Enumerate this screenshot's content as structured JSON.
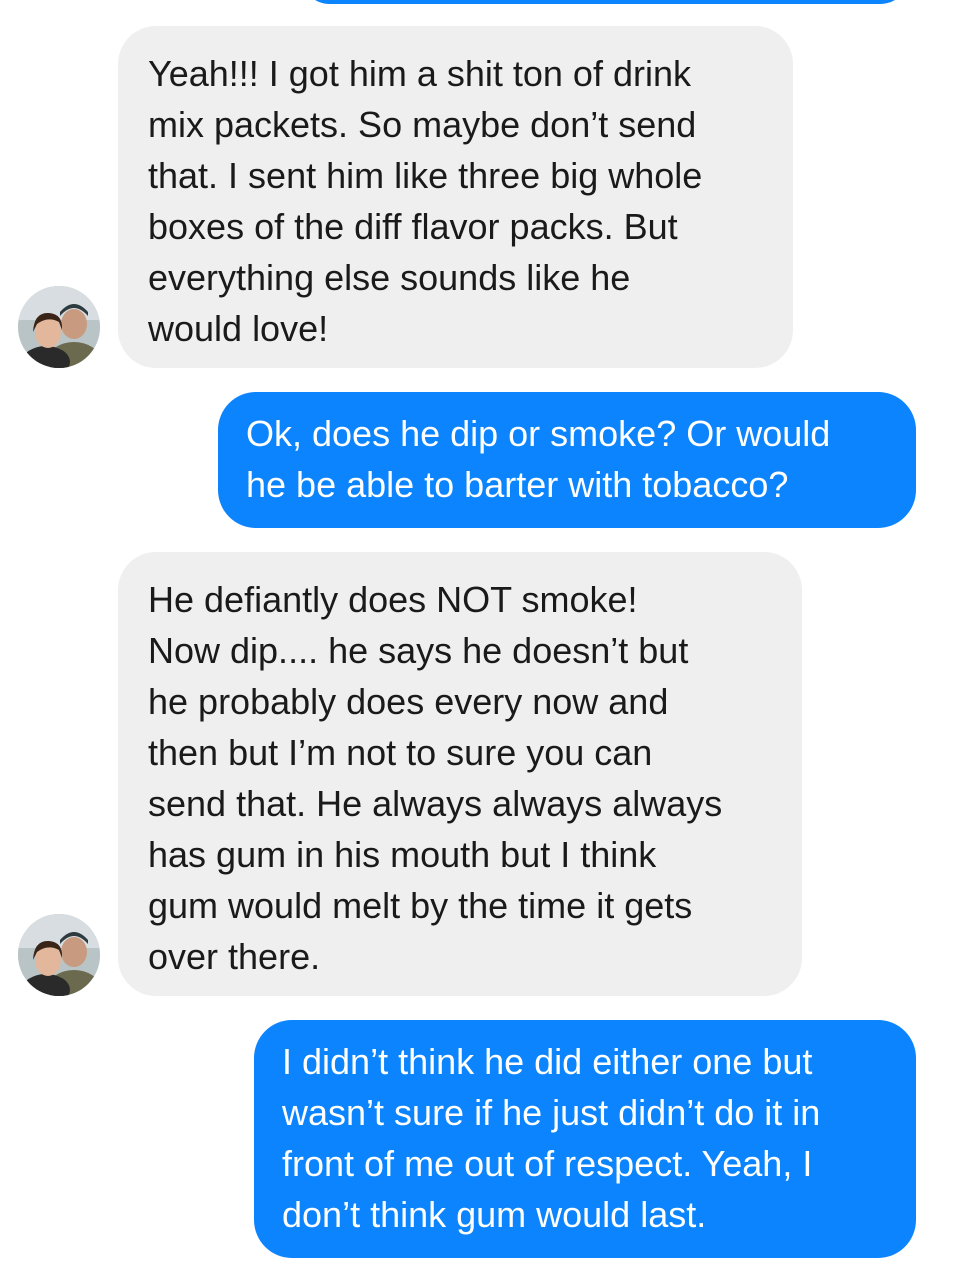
{
  "conversation": {
    "messages": [
      {
        "direction": "incoming",
        "text": "Yeah!!! I got him a shit ton of drink\nmix packets. So maybe don’t send\nthat. I sent him like three big whole\nboxes of the diff flavor packs. But\neverything else sounds like he\nwould love!",
        "avatar_icon": "contact-avatar-icon"
      },
      {
        "direction": "outgoing",
        "text": "Ok, does he dip or smoke? Or would\nhe be able to barter with tobacco?"
      },
      {
        "direction": "incoming",
        "text": "He defiantly does NOT smoke!\nNow dip.... he says he doesn’t but\nhe probably does every now and\nthen but I’m not to sure you can\nsend that. He always always always\nhas gum in his mouth but I think\ngum  would melt by the time it gets\nover there.",
        "avatar_icon": "contact-avatar-icon"
      },
      {
        "direction": "outgoing",
        "text": "I didn’t think he did either one but\nwasn’t sure if he just didn’t do it in\nfront of me out of respect. Yeah, I\ndon’t think gum would last."
      }
    ]
  },
  "colors": {
    "outgoing_bubble": "#0b84fe",
    "incoming_bubble": "#efefef",
    "outgoing_text": "#ffffff",
    "incoming_text": "#1a1a1a"
  }
}
